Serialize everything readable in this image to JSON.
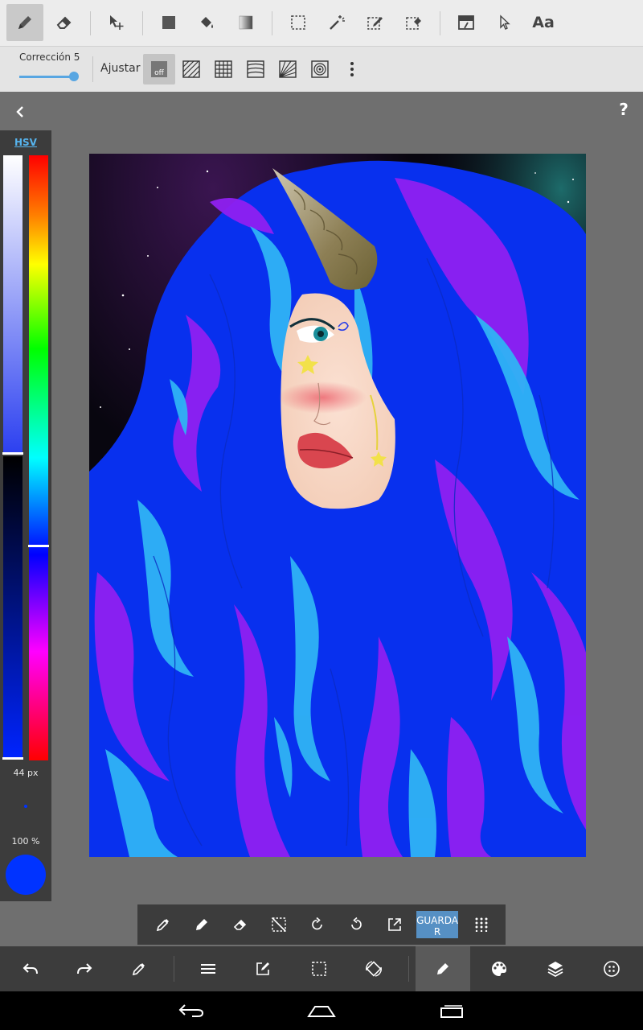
{
  "toolbar": {
    "tools": [
      "pen-icon",
      "eraser-icon",
      "move-icon",
      "rect-fill-icon",
      "bucket-icon",
      "gradient-icon",
      "select-rect-icon",
      "magic-wand-icon",
      "select-pen-icon",
      "select-eraser-icon",
      "layer-op-icon",
      "cursor-icon"
    ],
    "text_tool_label": "Aa"
  },
  "subbar": {
    "correction_label": "Corrección 5",
    "correction_value": 5,
    "snap_label": "Ajustar",
    "snap_off_label": "off"
  },
  "color_panel": {
    "mode_label": "HSV",
    "brush_size_label": "44 px",
    "opacity_label": "100 %",
    "current_color": "#0033ff"
  },
  "floatbar": {
    "save_label": "GUARDAR"
  },
  "colors": {
    "accent": "#58a6e2",
    "panel": "#3c3c3c",
    "toolbar": "#ececec"
  }
}
